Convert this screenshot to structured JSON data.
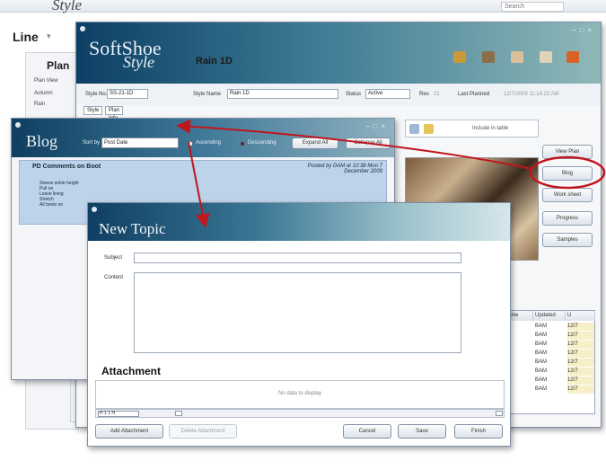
{
  "background_app": {
    "logo": "Style",
    "search_placeholder": "Search",
    "line_label": "Line",
    "plan_label": "Plan",
    "panel_items": [
      "Plan View",
      "Autumn",
      "Rain"
    ]
  },
  "main_window": {
    "logo_top": "SoftShoe",
    "logo_style": "Style",
    "title": "Rain 1D",
    "fields": {
      "style_no_label": "Style No.",
      "style_no_value": "SS-21-1D",
      "style_name_label": "Style Name",
      "style_name_value": "Rain 1D",
      "status_label": "Status",
      "status_value": "Active",
      "rev_label": "Rev.",
      "rev_value": "21",
      "last_planned_label": "Last Planned",
      "last_planned_value": "12/7/2009 11:14:22 AM"
    },
    "tabs": [
      "Style",
      "Plan Info"
    ],
    "photo_toolbar_label": "Include in table",
    "side_buttons": [
      "View Plan",
      "Blog",
      "Work sheet",
      "Progress",
      "Samples"
    ],
    "grid_headers": [
      "Line",
      "Updated",
      "U"
    ],
    "grid_rows": [
      [
        "",
        "BAM",
        "12/7"
      ],
      [
        "",
        "BAM",
        "12/7"
      ],
      [
        "",
        "BAM",
        "12/7"
      ],
      [
        "",
        "BAM",
        "12/7"
      ],
      [
        "",
        "BAM",
        "12/7"
      ],
      [
        "",
        "BAM",
        "12/7"
      ],
      [
        "",
        "BAM",
        "12/7"
      ],
      [
        "",
        "BAM",
        "12/7"
      ]
    ]
  },
  "blog_window": {
    "title": "Blog",
    "sort_label": "Sort by",
    "sort_value": "Post Date",
    "radio_ascending": "Ascending",
    "radio_descending": "Descending",
    "expand_all": "Expand All",
    "collapse_all": "Collapse All",
    "post": {
      "title": "PD Comments on Boot",
      "meta": "Posted by DAM at 10:38 Mon 7 December 2009",
      "items": [
        "Sleeve ankle height",
        "Pull on",
        "Leave lining",
        "Stretch",
        "All boots on"
      ]
    }
  },
  "topic_window": {
    "title": "New Topic",
    "subject_label": "Subject",
    "content_label": "Content",
    "attachment_heading": "Attachment",
    "no_data": "No data to display",
    "pager": "H 1 1 H",
    "buttons": {
      "add_attachment": "Add Attachment",
      "delete_attachment": "Delete Attachment",
      "cancel": "Cancel",
      "save": "Save",
      "finish": "Finish"
    }
  },
  "colors": {
    "title_gradient_dark": "#0f3f62",
    "blog_post_bg": "#bcd3ea",
    "annotation_red": "#c0161d"
  }
}
